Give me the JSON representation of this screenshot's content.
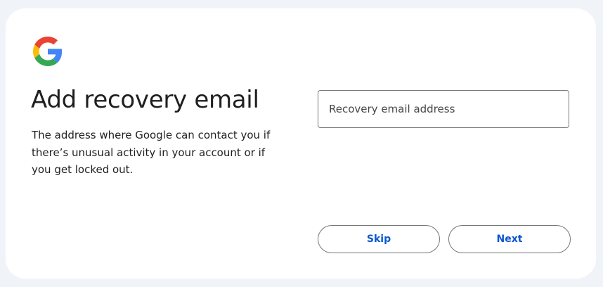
{
  "page": {
    "title": "Add recovery email",
    "description": "The address where Google can contact you if there’s unusual activity in your account or if you get locked out."
  },
  "logo": {
    "icon": "google-g-logo-icon",
    "colors": {
      "red": "#ea4335",
      "yellow": "#fbbc05",
      "green": "#34a853",
      "blue": "#4285f4"
    }
  },
  "recovery_email": {
    "placeholder": "Recovery email address",
    "value": ""
  },
  "actions": {
    "skip_label": "Skip",
    "next_label": "Next"
  },
  "colors": {
    "page_background": "#f0f4f9",
    "card_background": "#ffffff",
    "accent": "#0b57d0",
    "text": "#1f1f1f",
    "border": "#747775"
  }
}
